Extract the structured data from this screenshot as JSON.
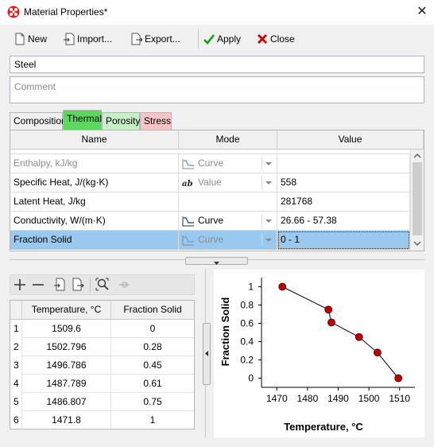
{
  "window": {
    "title": "Material Properties*",
    "close_glyph": "✕"
  },
  "toolbar": {
    "new": "New",
    "import": "Import...",
    "export": "Export...",
    "apply": "Apply",
    "close": "Close"
  },
  "material": {
    "name": "Steel",
    "comment_placeholder": "Comment"
  },
  "tabs": [
    {
      "label": "Composition",
      "color": "#f0f0f0"
    },
    {
      "label": "Thermal",
      "color": "#5fd65f"
    },
    {
      "label": "Porosity",
      "color": "#c8f0c8"
    },
    {
      "label": "Stress",
      "color": "#f6c4c4"
    }
  ],
  "properties": {
    "headers": [
      "Name",
      "Mode",
      "Value"
    ],
    "rows": [
      {
        "name": "Enthalpy, kJ/kg",
        "mode": "Curve",
        "value": "",
        "enabled": false
      },
      {
        "name": "Specific Heat, J/(kg·K)",
        "mode": "Value",
        "value": "558",
        "enabled": true
      },
      {
        "name": "Latent Heat, J/kg",
        "mode": "",
        "value": "281768",
        "enabled": true
      },
      {
        "name": "Conductivity, W/(m·K)",
        "mode": "Curve",
        "value": "26.66 - 57.38",
        "enabled": true
      },
      {
        "name": "Fraction Solid",
        "mode": "Curve",
        "value": "0 - 1",
        "enabled": true,
        "selected": true
      }
    ]
  },
  "curve_table": {
    "headers": [
      "Temperature, °C",
      "Fraction Solid"
    ],
    "rows": [
      {
        "index": "1",
        "temperature": "1509.6",
        "fraction": "0"
      },
      {
        "index": "2",
        "temperature": "1502.796",
        "fraction": "0.28"
      },
      {
        "index": "3",
        "temperature": "1496.786",
        "fraction": "0.45"
      },
      {
        "index": "4",
        "temperature": "1487.789",
        "fraction": "0.61"
      },
      {
        "index": "5",
        "temperature": "1486.807",
        "fraction": "0.75"
      },
      {
        "index": "6",
        "temperature": "1471.8",
        "fraction": "1"
      }
    ]
  },
  "chart_data": {
    "type": "scatter",
    "xlabel": "Temperature, °C",
    "ylabel": "Fraction Solid",
    "x": [
      1509.6,
      1502.796,
      1496.786,
      1487.789,
      1486.807,
      1471.8
    ],
    "y": [
      0,
      0.28,
      0.45,
      0.61,
      0.75,
      1
    ],
    "xlim": [
      1465,
      1515
    ],
    "ylim": [
      -0.1,
      1.1
    ],
    "xticks": [
      "1470",
      "1480",
      "1490",
      "1500",
      "1510"
    ],
    "yticks": [
      "0",
      "0.2",
      "0.4",
      "0.6",
      "0.8",
      "1"
    ],
    "marker_color": "#c00000",
    "line_color": "#000000",
    "grid": false
  },
  "colors": {
    "selection": "#99c9ef",
    "accent_red": "#d40000"
  }
}
